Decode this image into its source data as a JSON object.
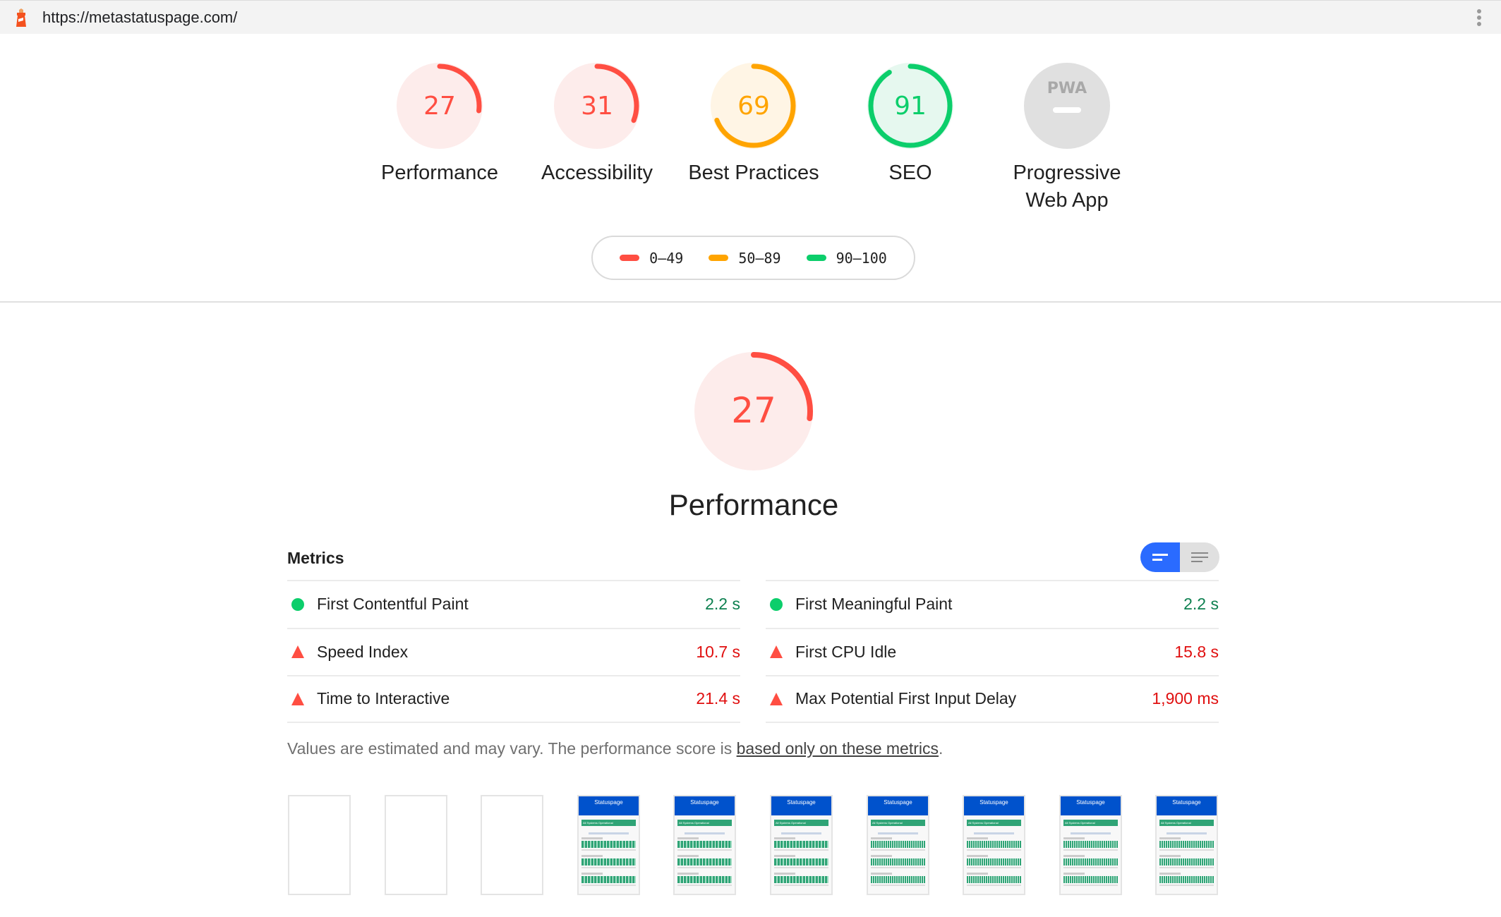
{
  "browser": {
    "url": "https://metastatuspage.com/",
    "site_icon": "lighthouse-icon",
    "menu_icon": "kebab-menu-icon"
  },
  "colors": {
    "fail": "#ff4e42",
    "average": "#ffa400",
    "pass": "#0cce6b",
    "fail_bg": "#fdeceb",
    "average_bg": "#fff5e5",
    "pass_bg": "#e6f8ef",
    "na": "#e0e0e0",
    "toggle_active": "#2a6bff"
  },
  "categories": [
    {
      "label": "Performance",
      "score": 27,
      "rating": "fail"
    },
    {
      "label": "Accessibility",
      "score": 31,
      "rating": "fail"
    },
    {
      "label": "Best Practices",
      "score": 69,
      "rating": "average"
    },
    {
      "label": "SEO",
      "score": 91,
      "rating": "pass"
    },
    {
      "label_line1": "Progressive",
      "label_line2": "Web App",
      "score": null,
      "rating": "na",
      "badge": "PWA"
    }
  ],
  "legend": [
    {
      "range": "0–49",
      "rating": "fail"
    },
    {
      "range": "50–89",
      "rating": "average"
    },
    {
      "range": "90–100",
      "rating": "pass"
    }
  ],
  "performance": {
    "score": 27,
    "title": "Performance",
    "metrics_header": "Metrics",
    "view_toggle": {
      "options": [
        "summary-view",
        "detailed-view"
      ],
      "active": "summary-view"
    },
    "metrics_left": [
      {
        "name": "First Contentful Paint",
        "value": "2.2 s",
        "status": "pass"
      },
      {
        "name": "Speed Index",
        "value": "10.7 s",
        "status": "fail"
      },
      {
        "name": "Time to Interactive",
        "value": "21.4 s",
        "status": "fail"
      }
    ],
    "metrics_right": [
      {
        "name": "First Meaningful Paint",
        "value": "2.2 s",
        "status": "pass"
      },
      {
        "name": "First CPU Idle",
        "value": "15.8 s",
        "status": "fail"
      },
      {
        "name": "Max Potential First Input Delay",
        "value": "1,900 ms",
        "status": "fail"
      }
    ],
    "footnote_text": "Values are estimated and may vary. The performance score is ",
    "footnote_link": "based only on these metrics",
    "footnote_end": "."
  },
  "filmstrip": {
    "frames": [
      {
        "blank": true
      },
      {
        "blank": true
      },
      {
        "blank": true
      },
      {
        "blank": false,
        "brand": "Statuspage",
        "banner": "All Systems Operational",
        "dense": false
      },
      {
        "blank": false,
        "brand": "Statuspage",
        "banner": "All Systems Operational",
        "dense": false
      },
      {
        "blank": false,
        "brand": "Statuspage",
        "banner": "All Systems Operational",
        "dense": false
      },
      {
        "blank": false,
        "brand": "Statuspage",
        "banner": "All Systems Operational",
        "dense": true
      },
      {
        "blank": false,
        "brand": "Statuspage",
        "banner": "All Systems Operational",
        "dense": true
      },
      {
        "blank": false,
        "brand": "Statuspage",
        "banner": "All Systems Operational",
        "dense": true
      },
      {
        "blank": false,
        "brand": "Statuspage",
        "banner": "All Systems Operational",
        "dense": true
      }
    ]
  }
}
